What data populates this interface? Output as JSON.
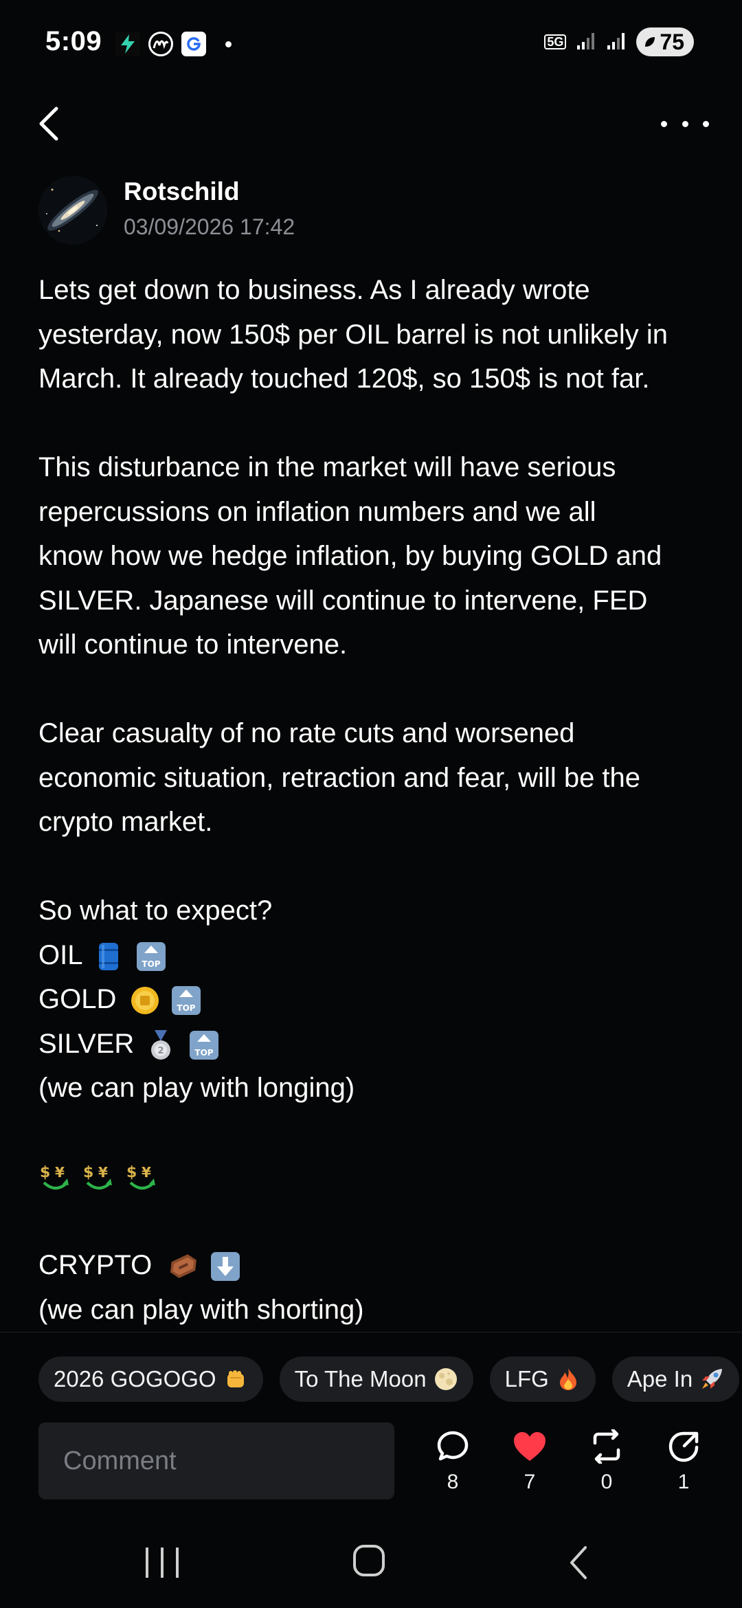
{
  "status_bar": {
    "time": "5:09",
    "network": "5G",
    "battery": "75"
  },
  "post": {
    "author": "Rotschild",
    "date": "03/09/2026 17:42",
    "paragraphs": [
      {
        "lines": [
          "Lets get down to business. As I already wrote",
          "yesterday, now 150$ per OIL barrel is not unlikely in",
          "March. It already touched 120$, so 150$ is not far."
        ]
      },
      {
        "lines": [
          "This disturbance in the market will have serious",
          "repercussions on inflation numbers and we all",
          "know how we hedge inflation, by buying GOLD and",
          "SILVER. Japanese will continue to intervene, FED",
          "will continue to intervene."
        ]
      },
      {
        "lines": [
          "Clear casualty of no rate cuts and worsened",
          "economic situation, retraction and fear, will be the",
          "crypto market."
        ]
      },
      {
        "lines": [
          "So what to expect?",
          "OIL",
          "GOLD",
          "SILVER",
          "(we can play with longing)"
        ]
      },
      {
        "lines": [
          "CRYPTO",
          "(we can play with shorting)"
        ]
      }
    ]
  },
  "reactions": [
    {
      "label": "2026 GOGOGO",
      "icon": "fist-emoji"
    },
    {
      "label": "To The Moon",
      "icon": "full-moon-emoji"
    },
    {
      "label": "LFG",
      "icon": "fire-emoji"
    },
    {
      "label": "Ape In",
      "icon": "rocket-emoji"
    }
  ],
  "comment": {
    "placeholder": "Comment"
  },
  "actions": {
    "comments": "8",
    "likes": "7",
    "reposts": "0",
    "shares": "1"
  },
  "colors": {
    "background": "#050607",
    "muted_text": "#8d9096",
    "chip_bg": "#1c1e22",
    "like_red": "#ff3b4a"
  }
}
